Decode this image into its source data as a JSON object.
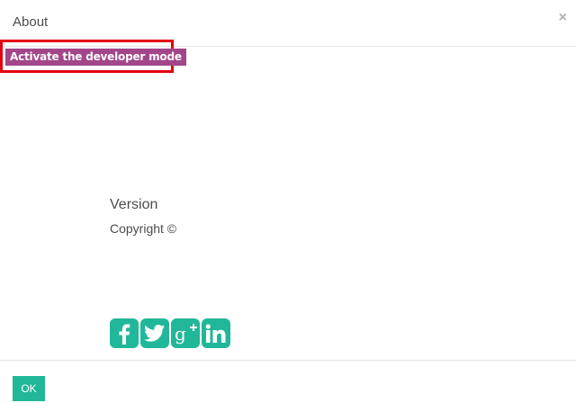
{
  "dialog": {
    "title": "About",
    "close_symbol": "×"
  },
  "developer_mode": {
    "label": "Activate the developer mode",
    "highlight_color": "#e4000f",
    "button_color": "#a24689"
  },
  "info": {
    "version_label": "Version",
    "copyright_label": "Copyright ©"
  },
  "social": {
    "accent_color": "#21b799",
    "icons": [
      "facebook-icon",
      "twitter-icon",
      "google-plus-icon",
      "linkedin-icon"
    ]
  },
  "footer": {
    "ok_label": "OK"
  }
}
